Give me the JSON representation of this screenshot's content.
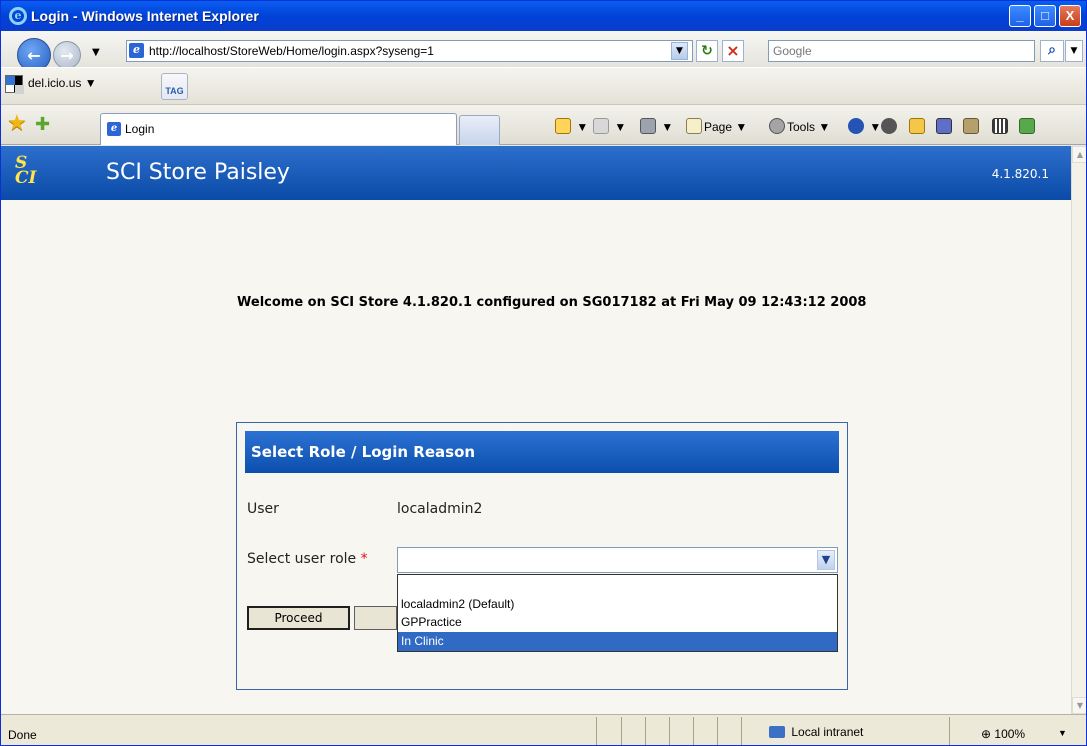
{
  "window": {
    "title": "Login - Windows Internet Explorer",
    "minimize_label": "_",
    "maximize_label": "□",
    "close_label": "X"
  },
  "navigation": {
    "address": "http://localhost/StoreWeb/Home/login.aspx?syseng=1",
    "search_placeholder": "Google",
    "links_item": "del.icio.us",
    "tag_label": "TAG",
    "tab_title": "Login",
    "page_menu": "Page",
    "tools_menu": "Tools"
  },
  "app": {
    "name": "SCI Store Paisley",
    "version": "4.1.820.1",
    "welcome": "Welcome on SCI Store 4.1.820.1 configured on SG017182 at Fri May 09 12:43:12 2008"
  },
  "panel": {
    "title": "Select Role / Login Reason",
    "user_label": "User",
    "user_value": "localadmin2",
    "role_label": "Select user role",
    "required_marker": "*",
    "selected_role": "",
    "options": [
      "localadmin2 (Default)",
      "GPPractice",
      "In Clinic"
    ],
    "highlighted_option": "In Clinic",
    "proceed_label": "Proceed"
  },
  "status": {
    "text": "Done",
    "zone": "Local intranet",
    "zoom": "100%"
  },
  "colors": {
    "app_header": "#0B4BA8",
    "selected_option": "#316AC5",
    "required_marker": "#E01010"
  }
}
